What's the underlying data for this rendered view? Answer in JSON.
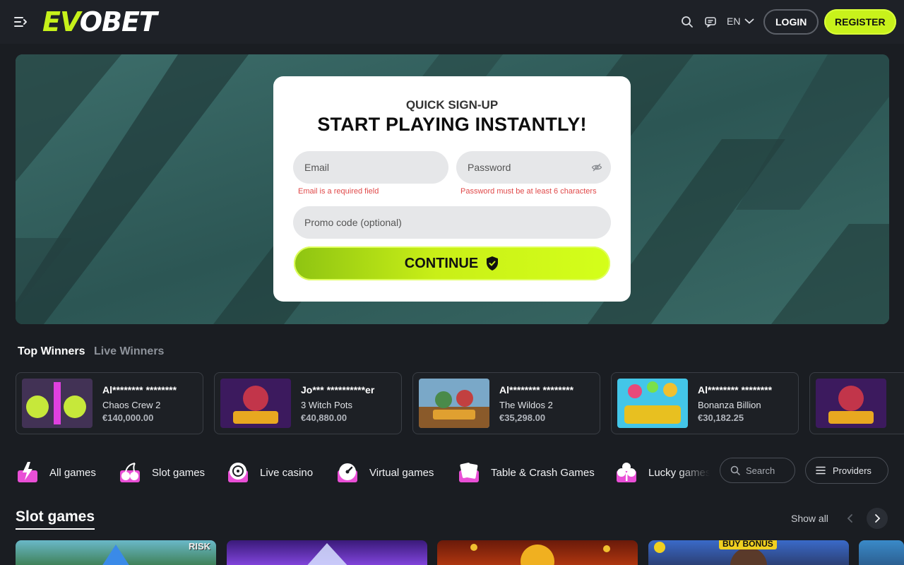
{
  "header": {
    "logo_text_left": "EV",
    "logo_text_right": "OBET",
    "language": "EN",
    "login_label": "LOGIN",
    "register_label": "REGISTER",
    "icons": [
      "menu-icon",
      "search-icon",
      "chat-icon",
      "chevron-down-icon"
    ]
  },
  "signup": {
    "subtitle": "QUICK SIGN-UP",
    "title": "START PLAYING INSTANTLY!",
    "email_placeholder": "Email",
    "email_error": "Email is a required field",
    "password_placeholder": "Password",
    "password_error": "Password must be at least 6 characters",
    "promo_placeholder": "Promo code (optional)",
    "continue_label": "CONTINUE"
  },
  "winners": {
    "tab_top": "Top Winners",
    "tab_live": "Live Winners",
    "items": [
      {
        "user": "Al******** ********",
        "game": "Chaos Crew 2",
        "amount": "€140,000.00"
      },
      {
        "user": "Jo*** **********er",
        "game": "3 Witch Pots",
        "amount": "€40,880.00"
      },
      {
        "user": "Al******** ********",
        "game": "The Wildos 2",
        "amount": "€35,298.00"
      },
      {
        "user": "Al******** ********",
        "game": "Bonanza Billion",
        "amount": "€30,182.25"
      }
    ]
  },
  "categories": {
    "items": [
      {
        "label": "All games"
      },
      {
        "label": "Slot games"
      },
      {
        "label": "Live casino"
      },
      {
        "label": "Virtual games"
      },
      {
        "label": "Table & Crash Games"
      },
      {
        "label": "Lucky games"
      }
    ],
    "search_placeholder": "Search",
    "providers_label": "Providers"
  },
  "slot_games": {
    "title": "Slot games",
    "show_all": "Show all",
    "tile_badges": [
      "RISK",
      "BUY BONUS"
    ]
  },
  "colors": {
    "accent": "#c8f21b",
    "background": "#1a1d22",
    "header": "#1e2127",
    "error": "#e04949"
  }
}
